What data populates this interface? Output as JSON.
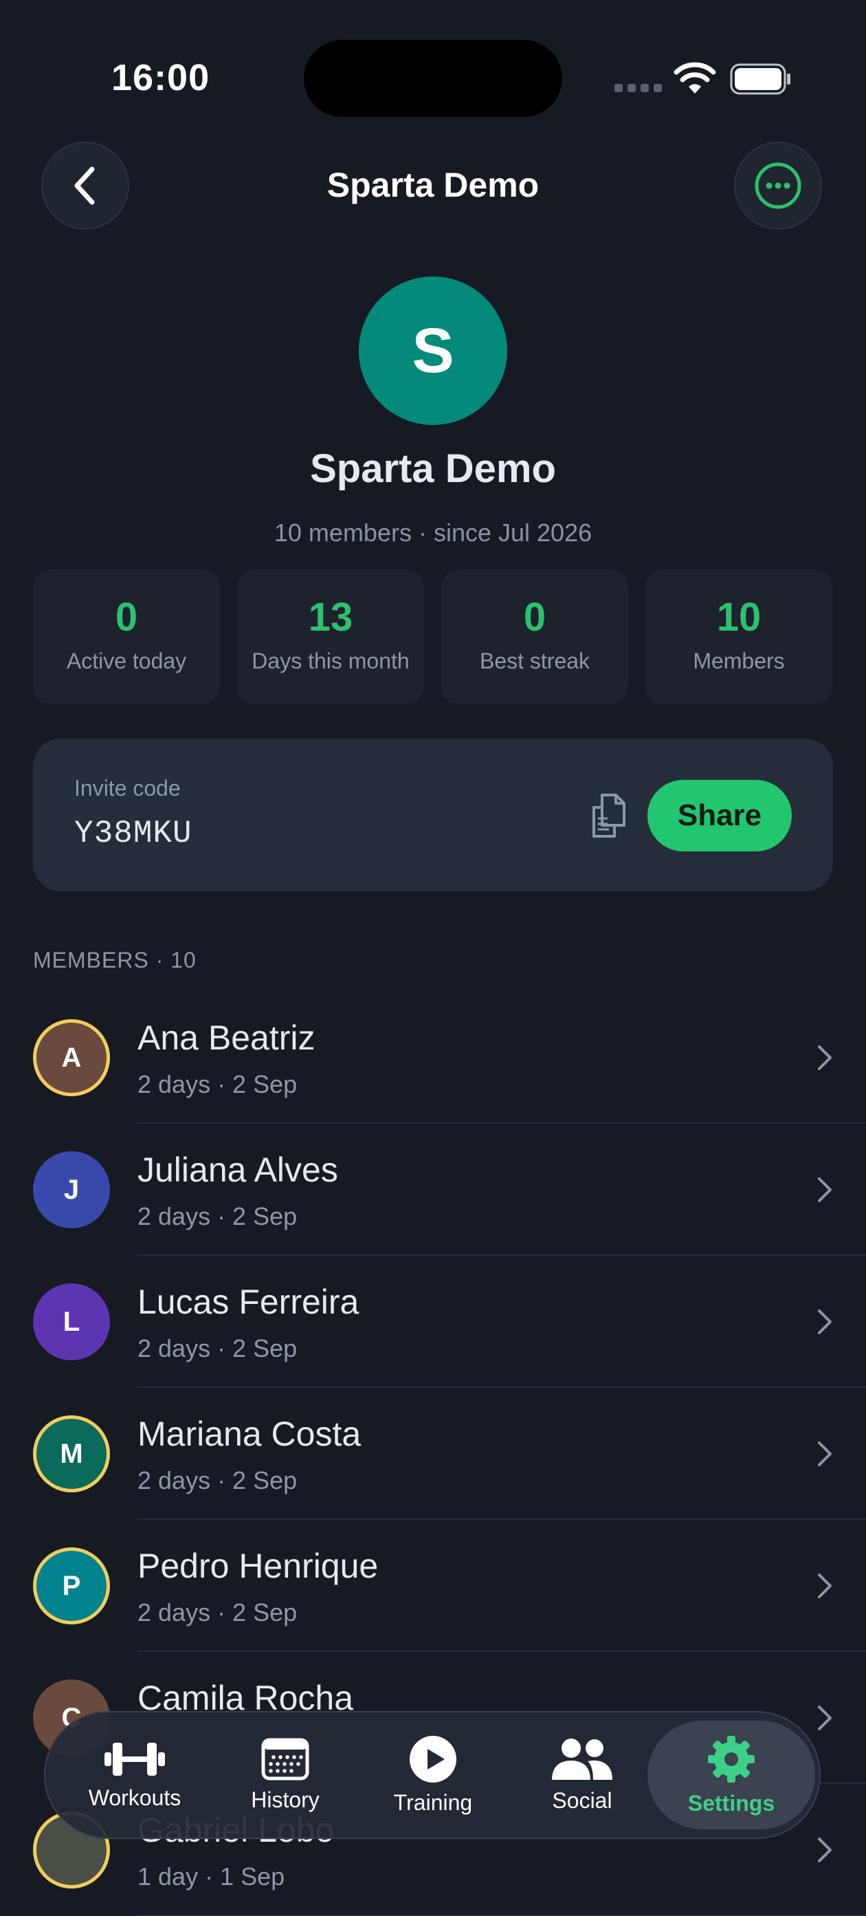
{
  "status": {
    "time": "16:00"
  },
  "nav": {
    "title": "Sparta Demo"
  },
  "group": {
    "initial": "S",
    "name": "Sparta Demo",
    "meta": "10 members · since Jul 2026"
  },
  "stats": [
    {
      "value": "0",
      "label": "Active today"
    },
    {
      "value": "13",
      "label": "Days this month"
    },
    {
      "value": "0",
      "label": "Best streak"
    },
    {
      "value": "10",
      "label": "Members"
    }
  ],
  "invite": {
    "label": "Invite code",
    "code": "Y38MKU",
    "share_label": "Share"
  },
  "members_header": "MEMBERS · 10",
  "members": [
    {
      "initial": "A",
      "name": "Ana Beatriz",
      "sub": "2 days · 2 Sep",
      "color": "#6b4a3e",
      "ring": true
    },
    {
      "initial": "J",
      "name": "Juliana Alves",
      "sub": "2 days · 2 Sep",
      "color": "#3949ab",
      "ring": false
    },
    {
      "initial": "L",
      "name": "Lucas Ferreira",
      "sub": "2 days · 2 Sep",
      "color": "#5e35b1",
      "ring": false
    },
    {
      "initial": "M",
      "name": "Mariana Costa",
      "sub": "2 days · 2 Sep",
      "color": "#0b6b5a",
      "ring": true
    },
    {
      "initial": "P",
      "name": "Pedro Henrique",
      "sub": "2 days · 2 Sep",
      "color": "#00838f",
      "ring": true
    },
    {
      "initial": "C",
      "name": "Camila Rocha",
      "sub": "",
      "color": "#6b4a3e",
      "ring": false
    },
    {
      "initial": "",
      "name": "Gabriel Lobo",
      "sub": "1 day · 1 Sep",
      "color": "#4a4f45",
      "ring": true
    }
  ],
  "tabs": [
    {
      "label": "Workouts",
      "icon": "dumbbell-icon"
    },
    {
      "label": "History",
      "icon": "calendar-icon"
    },
    {
      "label": "Training",
      "icon": "play-circle-icon"
    },
    {
      "label": "Social",
      "icon": "people-icon"
    },
    {
      "label": "Settings",
      "icon": "gear-icon",
      "active": true
    }
  ],
  "colors": {
    "accent": "#22c66f",
    "background": "#161a23",
    "group_avatar": "#048a7a"
  }
}
